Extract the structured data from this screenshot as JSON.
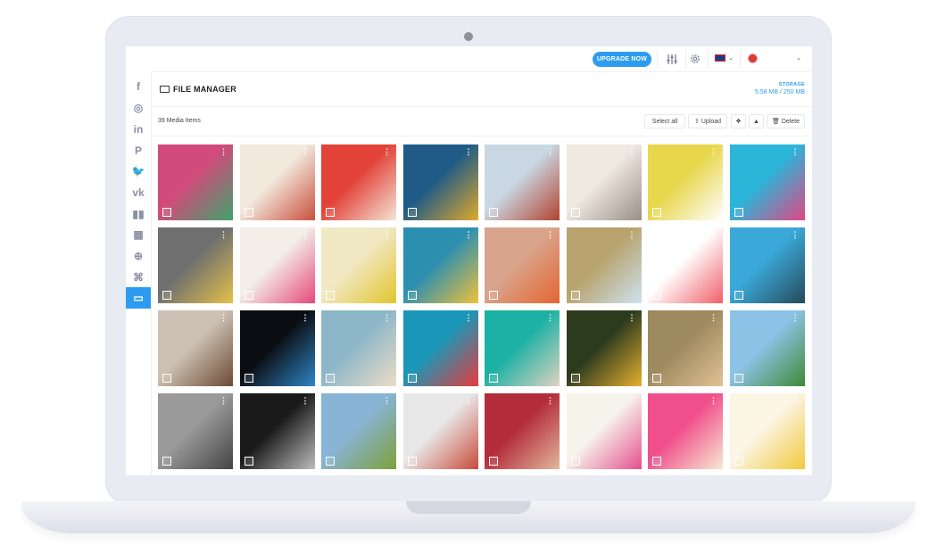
{
  "topbar": {
    "upgrade_label": "UPGRADE NOW",
    "icons": [
      "sliders-icon",
      "gear-icon",
      "flag-uk-icon",
      "chevron-down-icon",
      "avatar-icon",
      "chevron-down-icon"
    ]
  },
  "sidebar": {
    "items": [
      {
        "name": "facebook",
        "glyph": "f"
      },
      {
        "name": "instagram",
        "glyph": "◎"
      },
      {
        "name": "linkedin",
        "glyph": "in"
      },
      {
        "name": "pinterest",
        "glyph": "P"
      },
      {
        "name": "twitter",
        "glyph": "🐦"
      },
      {
        "name": "vk",
        "glyph": "vk"
      },
      {
        "name": "analytics",
        "glyph": "▮▮"
      },
      {
        "name": "calendar",
        "glyph": "▦"
      },
      {
        "name": "add",
        "glyph": "⊕"
      },
      {
        "name": "command",
        "glyph": "⌘"
      },
      {
        "name": "file-manager",
        "glyph": "▭",
        "active": true
      }
    ]
  },
  "header": {
    "title": "FILE MANAGER",
    "storage_label": "STORAGE",
    "storage_value": "5.58 MB / 250 MB"
  },
  "toolbar": {
    "count": "39 Media Items",
    "select_all": "Select all",
    "upload": "Upload",
    "delete": "Delete"
  },
  "media": [
    {
      "c1": "#d04b7b",
      "c2": "#3fa36b"
    },
    {
      "c1": "#f2e8dc",
      "c2": "#c9503e"
    },
    {
      "c1": "#e24238",
      "c2": "#f3e6d8"
    },
    {
      "c1": "#1f5b86",
      "c2": "#e0a92a"
    },
    {
      "c1": "#c9d7e3",
      "c2": "#b2432f"
    },
    {
      "c1": "#efe9e2",
      "c2": "#9a8f86"
    },
    {
      "c1": "#e8d64b",
      "c2": "#ffffff"
    },
    {
      "c1": "#2bb5d9",
      "c2": "#e24683"
    },
    {
      "c1": "#6f6f6f",
      "c2": "#e5c14a"
    },
    {
      "c1": "#f3efe8",
      "c2": "#e6487a"
    },
    {
      "c1": "#f1e8c4",
      "c2": "#e3c52c"
    },
    {
      "c1": "#2c8fb0",
      "c2": "#f0c13a"
    },
    {
      "c1": "#d9a48c",
      "c2": "#e56530"
    },
    {
      "c1": "#b8a36e",
      "c2": "#cfe2f0"
    },
    {
      "c1": "#ffffff",
      "c2": "#f05f6a"
    },
    {
      "c1": "#3aa8d8",
      "c2": "#264a5a"
    },
    {
      "c1": "#ccc1b4",
      "c2": "#6c4a33"
    },
    {
      "c1": "#0b0d12",
      "c2": "#2f86c7"
    },
    {
      "c1": "#8db7c9",
      "c2": "#ecdcc5"
    },
    {
      "c1": "#1a97b8",
      "c2": "#e83a3a"
    },
    {
      "c1": "#1bb1a5",
      "c2": "#e1d2c0"
    },
    {
      "c1": "#2c3b1e",
      "c2": "#e6b030"
    },
    {
      "c1": "#9d8a5e",
      "c2": "#e4c096"
    },
    {
      "c1": "#8cc2e6",
      "c2": "#3f8a36"
    },
    {
      "c1": "#9a9a9a",
      "c2": "#444444"
    },
    {
      "c1": "#1a1a1a",
      "c2": "#bdbdbd"
    },
    {
      "c1": "#88b4d6",
      "c2": "#7fa03a"
    },
    {
      "c1": "#e8e8e8",
      "c2": "#c94a3a"
    },
    {
      "c1": "#b32c3a",
      "c2": "#e2b79c"
    },
    {
      "c1": "#f7f4ec",
      "c2": "#e3508e"
    },
    {
      "c1": "#f04f8b",
      "c2": "#f7ebd0"
    },
    {
      "c1": "#fbf5e4",
      "c2": "#f2c93b"
    }
  ]
}
